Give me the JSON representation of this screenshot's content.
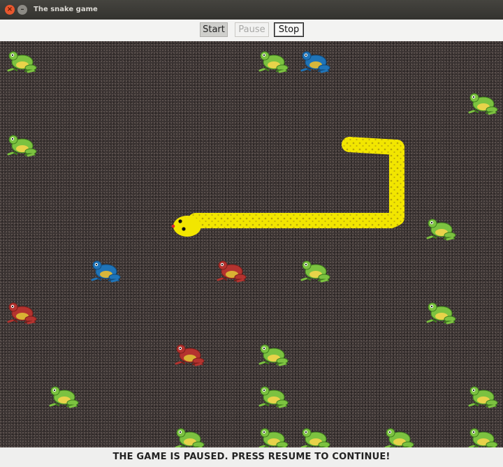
{
  "window": {
    "title": "The snake game"
  },
  "toolbar": {
    "start_label": "Start",
    "pause_label": "Pause",
    "stop_label": "Stop"
  },
  "status": {
    "message": "THE GAME IS PAUSED. PRESS RESUME TO CONTINUE!"
  },
  "colors": {
    "green_frog": "#7cc240",
    "blue_frog": "#1f74b8",
    "red_frog": "#b4332f",
    "snake": "#f2e600",
    "board": "#3a3332"
  },
  "board": {
    "frogs": [
      {
        "color": "green",
        "col": 0,
        "row": 0
      },
      {
        "color": "green",
        "col": 6,
        "row": 0
      },
      {
        "color": "blue",
        "col": 7,
        "row": 0
      },
      {
        "color": "green",
        "col": 11,
        "row": 1
      },
      {
        "color": "green",
        "col": 0,
        "row": 2
      },
      {
        "color": "green",
        "col": 10,
        "row": 4
      },
      {
        "color": "blue",
        "col": 2,
        "row": 5
      },
      {
        "color": "red",
        "col": 5,
        "row": 5
      },
      {
        "color": "green",
        "col": 7,
        "row": 5
      },
      {
        "color": "red",
        "col": 0,
        "row": 6
      },
      {
        "color": "green",
        "col": 10,
        "row": 6
      },
      {
        "color": "red",
        "col": 4,
        "row": 7
      },
      {
        "color": "green",
        "col": 6,
        "row": 7
      },
      {
        "color": "green",
        "col": 1,
        "row": 8
      },
      {
        "color": "green",
        "col": 6,
        "row": 8
      },
      {
        "color": "green",
        "col": 11,
        "row": 8
      },
      {
        "color": "green",
        "col": 4,
        "row": 9
      },
      {
        "color": "green",
        "col": 6,
        "row": 9
      },
      {
        "color": "green",
        "col": 7,
        "row": 9
      },
      {
        "color": "green",
        "col": 9,
        "row": 9
      },
      {
        "color": "green",
        "col": 11,
        "row": 9
      }
    ],
    "snake": {
      "heading": "left"
    }
  }
}
